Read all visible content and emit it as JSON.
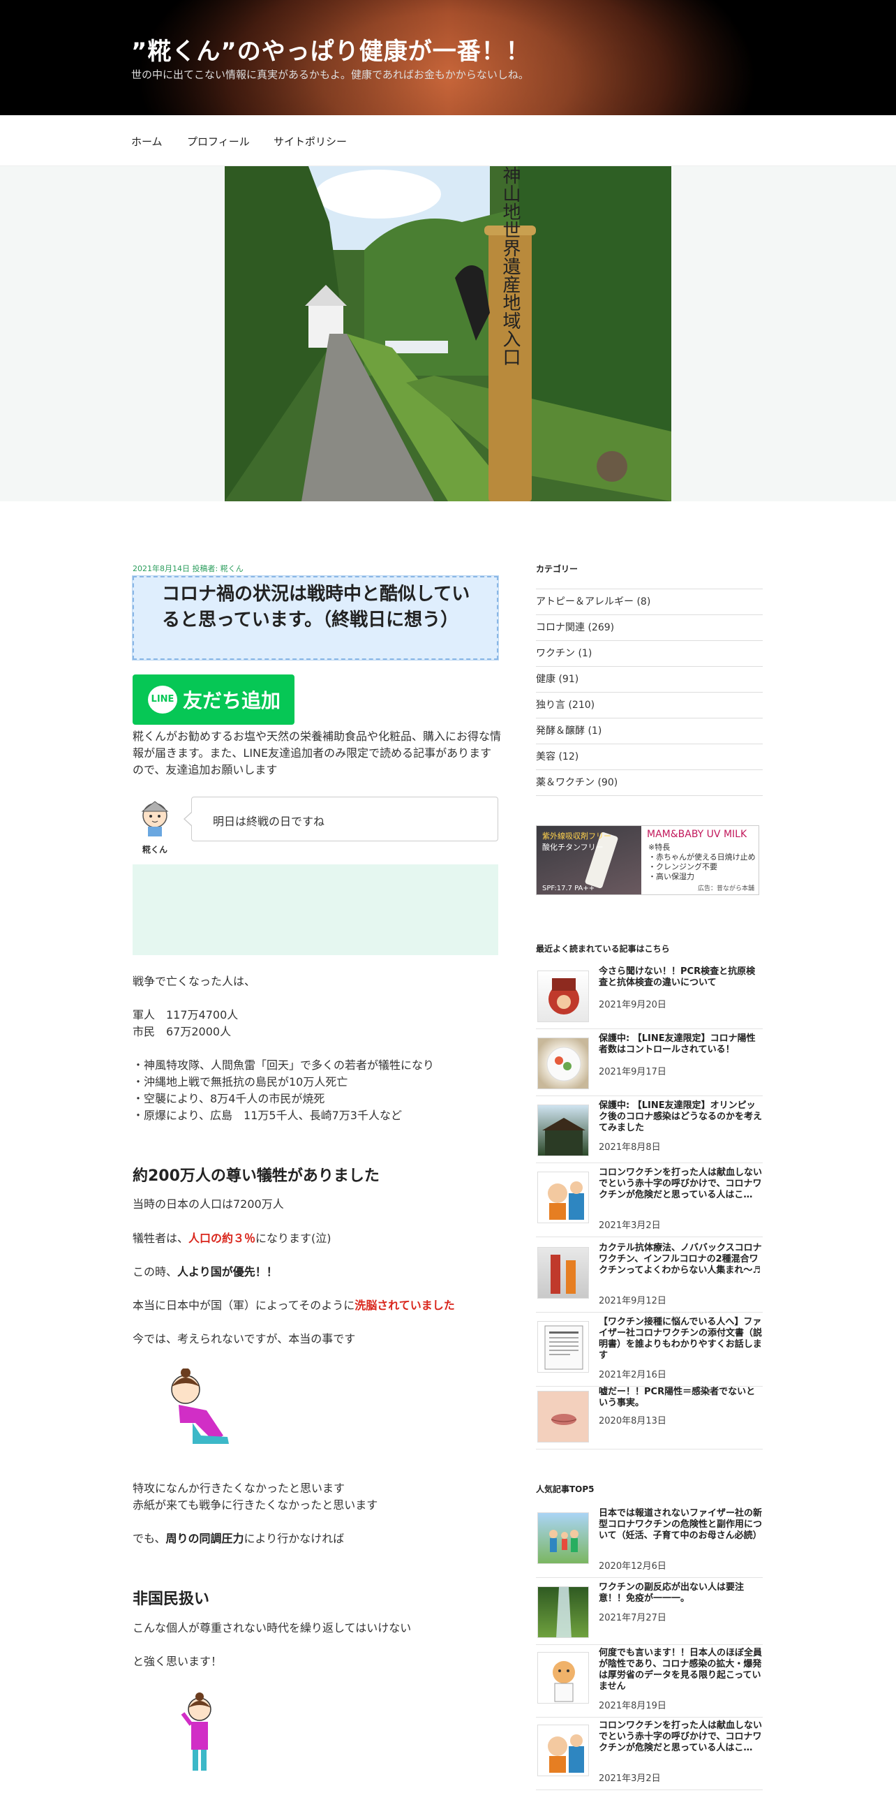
{
  "header": {
    "title": "”糀くん”のやっぱり健康が一番！！",
    "description": "世の中に出てこない情報に真実があるかもよ。健康であればお金もかからないしね。"
  },
  "nav": {
    "items": [
      "ホーム",
      "プロフィール",
      "サイトポリシー"
    ]
  },
  "hero": {
    "sign_text": "白神山地世界遺産地域入口"
  },
  "post": {
    "meta": "2021年8月14日 投稿者: 糀くん",
    "title": "コロナ禍の状況は戦時中と酷似していると思っています。（終戦日に想う）",
    "line_logo": "LINE",
    "line_button": "友だち追加",
    "line_desc": "糀くんがお勧めするお塩や天然の栄養補助食品や化粧品、購入にお得な情報が届きます。また、LINE友達追加者のみ限定で読める記事がありますので、友達追加お願いします",
    "speaker": "糀くん",
    "bubble": "明日は終戦の日ですね",
    "p1": "戦争で亡くなった人は、",
    "p2a": "軍人　117万4700人",
    "p2b": "市民　67万2000人",
    "bullets": [
      "・神風特攻隊、人間魚雷「回天」で多くの若者が犠牲になり",
      "・沖縄地上戦で無抵抗の島民が10万人死亡",
      "・空襲により、8万4千人の市民が焼死",
      "・原爆により、広島　11万5千人、長崎7万3千人など"
    ],
    "h2_1": "約200万人の尊い犠牲がありました",
    "p3": "当時の日本の人口は7200万人",
    "p4a": "犠牲者は、",
    "p4b": "人口の約３％",
    "p4c": "になります(泣)",
    "p5a": "この時、",
    "p5b": "人より国が優先！！",
    "p6a": "本当に日本中が国（軍）によってそのように",
    "p6b": "洗脳されていました",
    "p7": "今では、考えられないですが、本当の事です",
    "p8a": "特攻になんか行きたくなかったと思います",
    "p8b": "赤紙が来ても戦争に行きたくなかったと思います",
    "p9a": "でも、",
    "p9b": "周りの同調圧力",
    "p9c": "により行かなければ",
    "h2_2": "非国民扱い",
    "p10": "こんな個人が尊重されない時代を繰り返してはいけない",
    "p11": "と強く思います！"
  },
  "sidebar": {
    "categories_heading": "カテゴリー",
    "categories": [
      "アトピー＆アレルギー (8)",
      "コロナ関連 (269)",
      "ワクチン (1)",
      "健康 (91)",
      "独り言 (210)",
      "発酵＆醸酵 (1)",
      "美容 (12)",
      "薬＆ワクチン (90)"
    ],
    "ad": {
      "l1": "紫外線吸収剤フリー",
      "l2": "酸化チタンフリー",
      "l3": "SPF:17.7  PA++",
      "brand": "MAM&BABY UV MILK",
      "lines": [
        "※特長",
        "・赤ちゃんが使える日焼け止め",
        "・クレンジング不要",
        "・高い保湿力"
      ],
      "foot": "広告：昔ながら本舗"
    },
    "recent_heading": "最近よく読まれている記事はこちら",
    "recent": [
      {
        "title": "今さら聞けない！！PCR検査と抗原検査と抗体検査の違いについて",
        "date": "2021年9月20日"
      },
      {
        "title": "保護中: 【LINE友達限定】コロナ陽性者数はコントロールされている！",
        "date": "2021年9月17日"
      },
      {
        "title": "保護中: 【LINE友達限定】オリンピック後のコロナ感染はどうなるのかを考えてみました",
        "date": "2021年8月8日"
      },
      {
        "title": "コロンワクチンを打った人は献血しないでという赤十字の呼びかけで、コロナワクチンが危険だと思っている人はこ…",
        "date": "2021年3月2日"
      },
      {
        "title": "カクテル抗体療法、ノババックスコロナワクチン、インフルコロナの2種混合ワクチンってよくわからない人集まれ～♬",
        "date": "2021年9月12日"
      },
      {
        "title": "【ワクチン接種に悩んでいる人へ】ファイザー社コロナワクチンの添付文書（説明書）を誰よりもわかりやすくお話します",
        "date": "2021年2月16日"
      },
      {
        "title": "嘘だー！！PCR陽性＝感染者でないという事実。",
        "date": "2020年8月13日"
      }
    ],
    "popular_heading": "人気記事TOP5",
    "popular": [
      {
        "title": "日本では報道されないファイザー社の新型コロナワクチンの危険性と副作用について（妊活、子育て中のお母さん必読）",
        "date": "2020年12月6日"
      },
      {
        "title": "ワクチンの副反応が出ない人は要注意！！免疫が一一一。",
        "date": "2021年7月27日"
      },
      {
        "title": "何度でも言います！！日本人のほぼ全員が陰性であり、コロナ感染の拡大・爆発は厚労省のデータを見る限り起こっていません",
        "date": "2021年8月19日"
      },
      {
        "title": "コロンワクチンを打った人は献血しないでという赤十字の呼びかけで、コロナワクチンが危険だと思っている人はこ…",
        "date": "2021年3月2日"
      }
    ]
  }
}
